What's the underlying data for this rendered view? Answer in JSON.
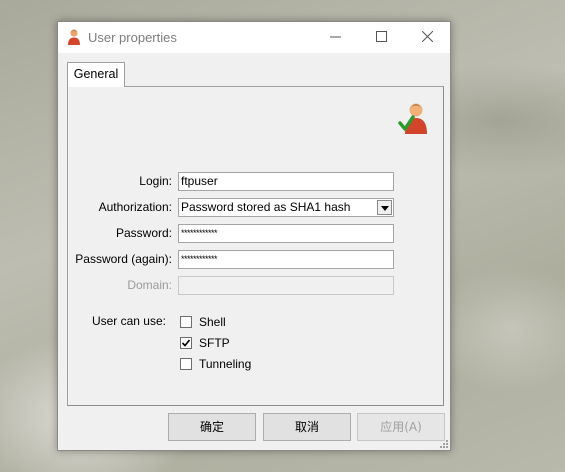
{
  "window": {
    "title": "User properties",
    "minimize_glyph": "—",
    "icons": {
      "title": "user-icon",
      "minimize": "minimize-icon",
      "maximize": "maximize-icon",
      "close": "close-icon"
    }
  },
  "tabs": [
    {
      "label": "General",
      "active": true
    }
  ],
  "form": {
    "login": {
      "label": "Login:",
      "value": "ftpuser"
    },
    "authorization": {
      "label": "Authorization:",
      "value": "Password stored as SHA1 hash"
    },
    "password": {
      "label": "Password:",
      "value": "************"
    },
    "password_again": {
      "label": "Password (again):",
      "value": "************"
    },
    "domain": {
      "label": "Domain:",
      "value": "",
      "enabled": false
    },
    "user_can_use": {
      "label": "User can use:",
      "options": [
        {
          "label": "Shell",
          "checked": false
        },
        {
          "label": "SFTP",
          "checked": true
        },
        {
          "label": "Tunneling",
          "checked": false
        }
      ]
    }
  },
  "buttons": {
    "ok": "确定",
    "cancel": "取消",
    "apply": "应用(A)",
    "apply_enabled": false
  },
  "colors": {
    "user_icon_shirt": "#d2452a",
    "check_green": "#2e9a2e"
  }
}
